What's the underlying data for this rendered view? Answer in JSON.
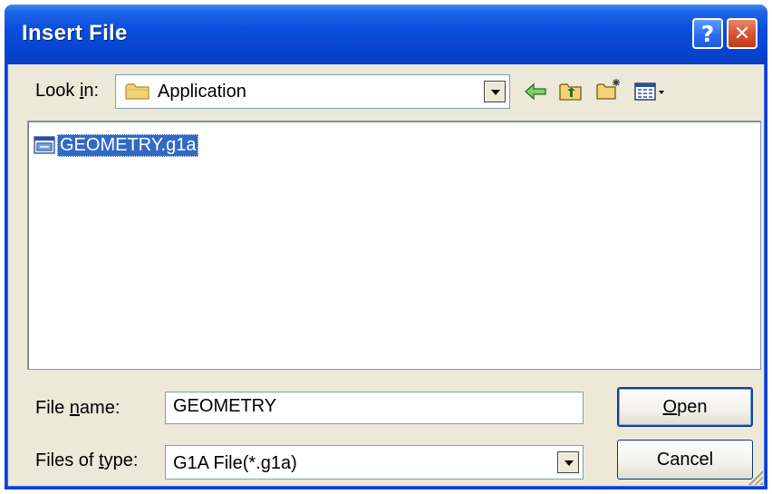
{
  "window": {
    "title": "Insert File",
    "help_label": "?",
    "close_label": "✕"
  },
  "look_in": {
    "label_pre": "Look ",
    "label_key": "i",
    "label_post": "n:",
    "value": "Application"
  },
  "toolbar": {
    "icons": [
      "back-arrow-icon",
      "up-folder-icon",
      "new-folder-icon",
      "view-menu-icon"
    ]
  },
  "files": [
    {
      "name": "GEOMETRY.g1a",
      "selected": true
    }
  ],
  "file_name": {
    "label_pre": "File ",
    "label_key": "n",
    "label_post": "ame:",
    "value": "GEOMETRY"
  },
  "file_type": {
    "label_pre": "Files of ",
    "label_key": "t",
    "label_post": "ype:",
    "value": "G1A File(*.g1a)"
  },
  "buttons": {
    "open_key": "O",
    "open_rest": "pen",
    "cancel": "Cancel"
  },
  "colors": {
    "title_bar": "#0a4fdc",
    "selection": "#316ac5",
    "dialog_bg": "#ece9d8"
  }
}
